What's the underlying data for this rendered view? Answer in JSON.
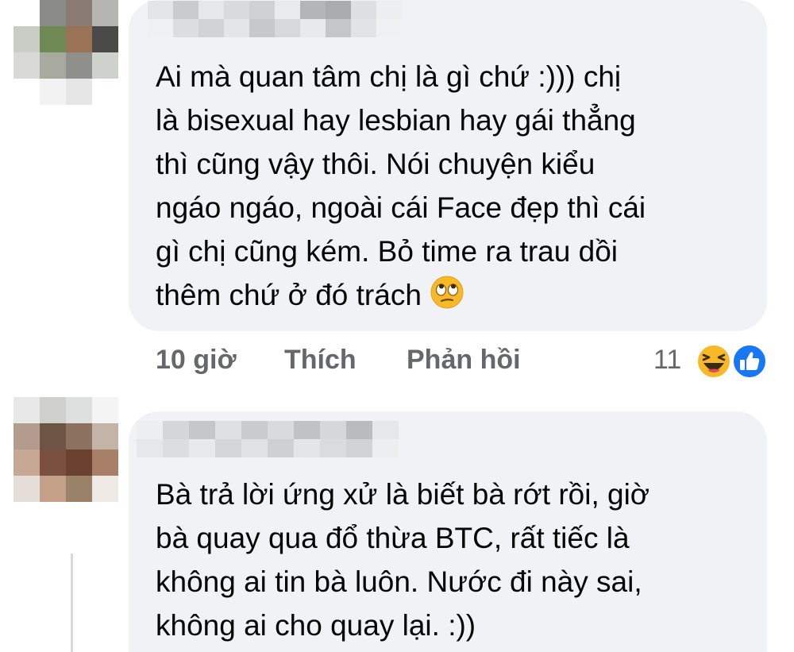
{
  "comments": [
    {
      "text": "Ai mà quan tâm chị là gì chứ :))) chị\nlà bisexual hay lesbian hay gái thẳng\nthì cũng vậy thôi. Nói chuyện kiểu\nngáo ngáo, ngoài cái Face đẹp thì cái\ngì chị cũng kém. Bỏ time ra trau dồi\nthêm chứ ở đó trách",
      "emoji": "face-with-rolling-eyes",
      "time": "10 giờ",
      "like_label": "Thích",
      "reply_label": "Phản hồi",
      "reaction_count": "11",
      "reactions": [
        "haha-icon",
        "like-icon"
      ]
    },
    {
      "text": "Bà trả lời ứng xử là biết bà rớt rồi, giờ\nbà quay qua đổ thừa BTC, rất tiếc là\nkhông ai tin bà luôn. Nước đi này sai,\nkhông ai cho quay lại. :))"
    }
  ],
  "colors": {
    "bubble": "#f0f2f5",
    "text": "#050505",
    "meta": "#65676b",
    "like_blue": "#1877f2",
    "haha_yellow": "#f7b928"
  }
}
